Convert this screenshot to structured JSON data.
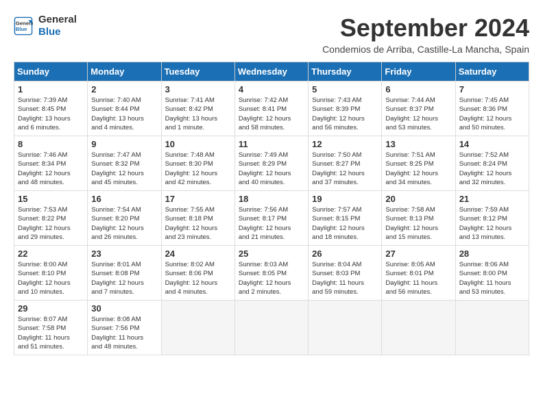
{
  "header": {
    "logo_line1": "General",
    "logo_line2": "Blue",
    "month_title": "September 2024",
    "location": "Condemios de Arriba, Castille-La Mancha, Spain"
  },
  "days_of_week": [
    "Sunday",
    "Monday",
    "Tuesday",
    "Wednesday",
    "Thursday",
    "Friday",
    "Saturday"
  ],
  "weeks": [
    [
      {
        "day": "1",
        "info": "Sunrise: 7:39 AM\nSunset: 8:45 PM\nDaylight: 13 hours\nand 6 minutes."
      },
      {
        "day": "2",
        "info": "Sunrise: 7:40 AM\nSunset: 8:44 PM\nDaylight: 13 hours\nand 4 minutes."
      },
      {
        "day": "3",
        "info": "Sunrise: 7:41 AM\nSunset: 8:42 PM\nDaylight: 13 hours\nand 1 minute."
      },
      {
        "day": "4",
        "info": "Sunrise: 7:42 AM\nSunset: 8:41 PM\nDaylight: 12 hours\nand 58 minutes."
      },
      {
        "day": "5",
        "info": "Sunrise: 7:43 AM\nSunset: 8:39 PM\nDaylight: 12 hours\nand 56 minutes."
      },
      {
        "day": "6",
        "info": "Sunrise: 7:44 AM\nSunset: 8:37 PM\nDaylight: 12 hours\nand 53 minutes."
      },
      {
        "day": "7",
        "info": "Sunrise: 7:45 AM\nSunset: 8:36 PM\nDaylight: 12 hours\nand 50 minutes."
      }
    ],
    [
      {
        "day": "8",
        "info": "Sunrise: 7:46 AM\nSunset: 8:34 PM\nDaylight: 12 hours\nand 48 minutes."
      },
      {
        "day": "9",
        "info": "Sunrise: 7:47 AM\nSunset: 8:32 PM\nDaylight: 12 hours\nand 45 minutes."
      },
      {
        "day": "10",
        "info": "Sunrise: 7:48 AM\nSunset: 8:30 PM\nDaylight: 12 hours\nand 42 minutes."
      },
      {
        "day": "11",
        "info": "Sunrise: 7:49 AM\nSunset: 8:29 PM\nDaylight: 12 hours\nand 40 minutes."
      },
      {
        "day": "12",
        "info": "Sunrise: 7:50 AM\nSunset: 8:27 PM\nDaylight: 12 hours\nand 37 minutes."
      },
      {
        "day": "13",
        "info": "Sunrise: 7:51 AM\nSunset: 8:25 PM\nDaylight: 12 hours\nand 34 minutes."
      },
      {
        "day": "14",
        "info": "Sunrise: 7:52 AM\nSunset: 8:24 PM\nDaylight: 12 hours\nand 32 minutes."
      }
    ],
    [
      {
        "day": "15",
        "info": "Sunrise: 7:53 AM\nSunset: 8:22 PM\nDaylight: 12 hours\nand 29 minutes."
      },
      {
        "day": "16",
        "info": "Sunrise: 7:54 AM\nSunset: 8:20 PM\nDaylight: 12 hours\nand 26 minutes."
      },
      {
        "day": "17",
        "info": "Sunrise: 7:55 AM\nSunset: 8:18 PM\nDaylight: 12 hours\nand 23 minutes."
      },
      {
        "day": "18",
        "info": "Sunrise: 7:56 AM\nSunset: 8:17 PM\nDaylight: 12 hours\nand 21 minutes."
      },
      {
        "day": "19",
        "info": "Sunrise: 7:57 AM\nSunset: 8:15 PM\nDaylight: 12 hours\nand 18 minutes."
      },
      {
        "day": "20",
        "info": "Sunrise: 7:58 AM\nSunset: 8:13 PM\nDaylight: 12 hours\nand 15 minutes."
      },
      {
        "day": "21",
        "info": "Sunrise: 7:59 AM\nSunset: 8:12 PM\nDaylight: 12 hours\nand 13 minutes."
      }
    ],
    [
      {
        "day": "22",
        "info": "Sunrise: 8:00 AM\nSunset: 8:10 PM\nDaylight: 12 hours\nand 10 minutes."
      },
      {
        "day": "23",
        "info": "Sunrise: 8:01 AM\nSunset: 8:08 PM\nDaylight: 12 hours\nand 7 minutes."
      },
      {
        "day": "24",
        "info": "Sunrise: 8:02 AM\nSunset: 8:06 PM\nDaylight: 12 hours\nand 4 minutes."
      },
      {
        "day": "25",
        "info": "Sunrise: 8:03 AM\nSunset: 8:05 PM\nDaylight: 12 hours\nand 2 minutes."
      },
      {
        "day": "26",
        "info": "Sunrise: 8:04 AM\nSunset: 8:03 PM\nDaylight: 11 hours\nand 59 minutes."
      },
      {
        "day": "27",
        "info": "Sunrise: 8:05 AM\nSunset: 8:01 PM\nDaylight: 11 hours\nand 56 minutes."
      },
      {
        "day": "28",
        "info": "Sunrise: 8:06 AM\nSunset: 8:00 PM\nDaylight: 11 hours\nand 53 minutes."
      }
    ],
    [
      {
        "day": "29",
        "info": "Sunrise: 8:07 AM\nSunset: 7:58 PM\nDaylight: 11 hours\nand 51 minutes."
      },
      {
        "day": "30",
        "info": "Sunrise: 8:08 AM\nSunset: 7:56 PM\nDaylight: 11 hours\nand 48 minutes."
      },
      {
        "day": "",
        "info": ""
      },
      {
        "day": "",
        "info": ""
      },
      {
        "day": "",
        "info": ""
      },
      {
        "day": "",
        "info": ""
      },
      {
        "day": "",
        "info": ""
      }
    ]
  ]
}
